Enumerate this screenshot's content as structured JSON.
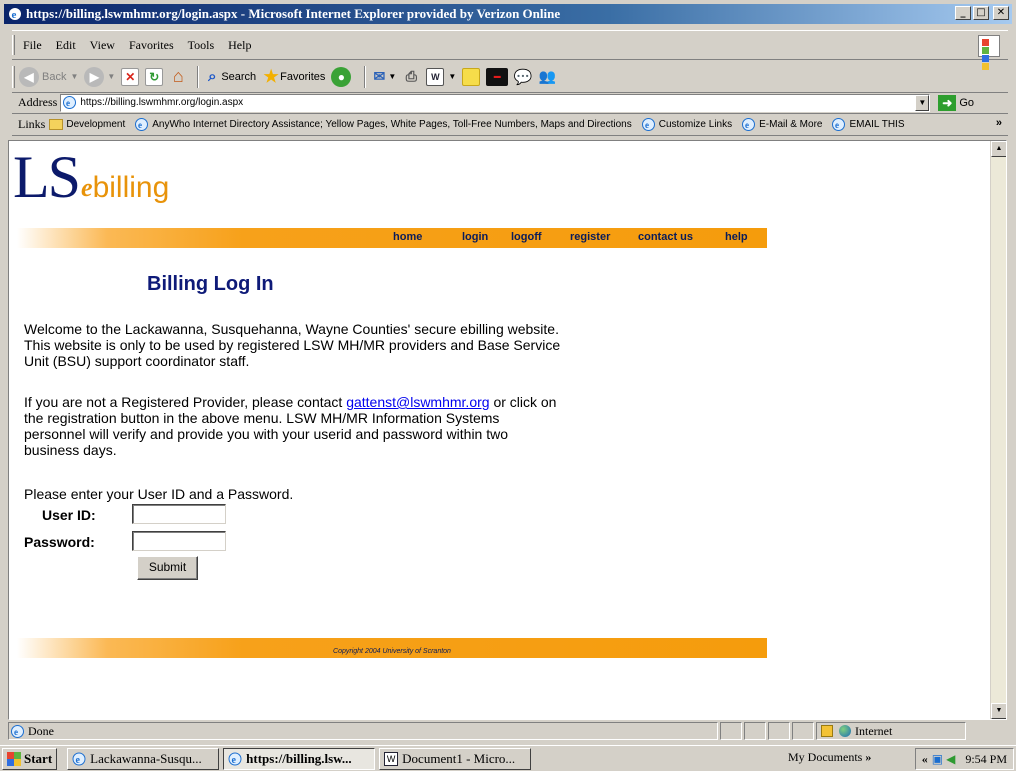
{
  "window": {
    "title": "https://billing.lswmhmr.org/login.aspx - Microsoft Internet Explorer provided by Verizon Online",
    "min_glyph": "_",
    "max_glyph": "□",
    "close_glyph": "✕"
  },
  "menu": [
    "File",
    "Edit",
    "View",
    "Favorites",
    "Tools",
    "Help"
  ],
  "toolbar": {
    "back": "Back",
    "search": "Search",
    "favorites": "Favorites"
  },
  "address": {
    "label": "Address",
    "url": "https://billing.lswmhmr.org/login.aspx",
    "go": "Go"
  },
  "links": {
    "label": "Links",
    "items": [
      "Development",
      "AnyWho Internet Directory Assistance; Yellow Pages, White Pages, Toll-Free Numbers, Maps and Directions",
      "Customize Links",
      "E-Mail & More",
      "EMAIL THIS"
    ]
  },
  "page": {
    "logo": {
      "ls": "LS",
      "e": "e",
      "billing": "billing"
    },
    "nav": [
      "home",
      "login",
      "logoff",
      "register",
      "contact us",
      "help"
    ],
    "heading": "Billing Log In",
    "welcome": "Welcome to the Lackawanna, Susquehanna, Wayne Counties' secure ebilling website. This website is only to be used by registered LSW MH/MR providers and Base Service Unit (BSU) support coordinator staff.",
    "contact_pre": "If you are not a Registered Provider, please contact ",
    "contact_email": "gattenst@lswmhmr.org",
    "contact_post": " or click on the registration button in the above menu.   LSW MH/MR Information Systems personnel will verify and provide you with your userid and password within two business days.",
    "instruction": "Please enter your User ID and a Password.",
    "userid_label": "User ID:",
    "password_label": "Password:",
    "userid_value": "",
    "password_value": "",
    "submit": "Submit",
    "copyright": "Copyright 2004   University of Scranton"
  },
  "status": {
    "text": "Done",
    "zone": "Internet"
  },
  "taskbar": {
    "start": "Start",
    "buttons": [
      "Lackawanna-Susqu...",
      "https://billing.lsw...",
      "Document1 - Micro..."
    ],
    "mydocs": "My Documents",
    "clock": "9:54 PM"
  },
  "colors": {
    "accent_orange": "#f59c0c",
    "nav_text": "#0a1c5a",
    "heading": "#0e1a78",
    "link": "#0000ee",
    "titlebar": "#0a246a"
  }
}
